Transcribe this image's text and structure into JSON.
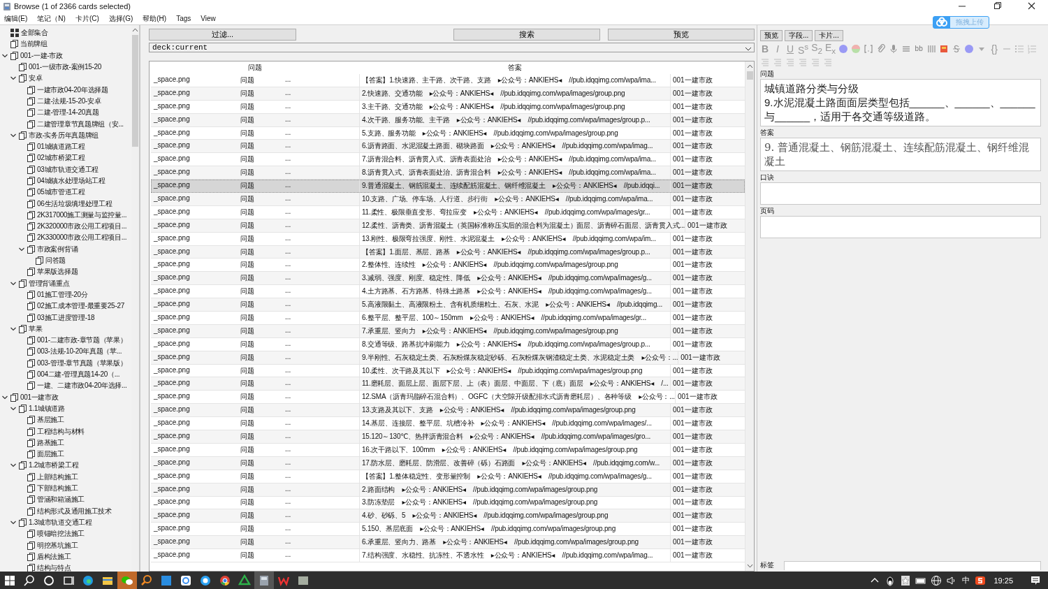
{
  "window": {
    "title": "Browse (1 of 2366 cards selected)"
  },
  "menu": [
    "编辑(E)",
    "笔记（N)",
    "卡片(C)",
    "选择(G)",
    "帮助(H)",
    "Tags",
    "View"
  ],
  "upload_button": {
    "label": "拖拽上传"
  },
  "sidebar": {
    "items": [
      {
        "label": "全部集合",
        "kind": "collection"
      },
      {
        "label": "当前牌组",
        "kind": "deck"
      },
      {
        "label": "001-一建-市政",
        "kind": "deck",
        "expanded": true,
        "children": [
          {
            "label": "001-一级市政-案例15-20",
            "kind": "deck"
          },
          {
            "label": "安卓",
            "kind": "deck",
            "expanded": true,
            "children": [
              {
                "label": "一建市政04-20年选择题",
                "kind": "deck"
              },
              {
                "label": "二建-法规-15-20-安卓",
                "kind": "deck"
              },
              {
                "label": "二建-管理-14-20真题",
                "kind": "deck"
              },
              {
                "label": "二建管理章节真题牌组（安...",
                "kind": "deck"
              }
            ]
          },
          {
            "label": "市政-实务历年真题牌组",
            "kind": "deck",
            "expanded": true,
            "children": [
              {
                "label": "01城镇道路工程",
                "kind": "deck"
              },
              {
                "label": "02城市桥梁工程",
                "kind": "deck"
              },
              {
                "label": "03城市轨道交通工程",
                "kind": "deck"
              },
              {
                "label": "04城镇水处理场站工程",
                "kind": "deck"
              },
              {
                "label": "05城市管道工程",
                "kind": "deck"
              },
              {
                "label": "06生活垃圾填埋处理工程",
                "kind": "deck"
              },
              {
                "label": "2K317000施工测量与监控量...",
                "kind": "deck"
              },
              {
                "label": "2K320000市政公用工程项目...",
                "kind": "deck"
              },
              {
                "label": "2K330000市政公用工程项目...",
                "kind": "deck"
              },
              {
                "label": "市政案例背诵",
                "kind": "deck",
                "expanded": true,
                "children": [
                  {
                    "label": "问答题",
                    "kind": "deck"
                  }
                ]
              },
              {
                "label": "苹果版选择题",
                "kind": "deck"
              }
            ]
          },
          {
            "label": "管理背诵重点",
            "kind": "deck",
            "expanded": true,
            "children": [
              {
                "label": "01施工管理-20分",
                "kind": "deck"
              },
              {
                "label": "02施工成本管理-最重要25-27",
                "kind": "deck"
              },
              {
                "label": "03施工进度管理-18",
                "kind": "deck"
              }
            ]
          },
          {
            "label": "苹果",
            "kind": "deck",
            "expanded": true,
            "children": [
              {
                "label": "001-二建市政-章节题（苹果）",
                "kind": "deck"
              },
              {
                "label": "003-法规-10-20年真题（苹...",
                "kind": "deck"
              },
              {
                "label": "003-管理-章节真题（苹果版）",
                "kind": "deck"
              },
              {
                "label": "004二建-管理真题14-20（...",
                "kind": "deck"
              },
              {
                "label": "一建、二建市政04-20年选择...",
                "kind": "deck"
              }
            ]
          }
        ]
      },
      {
        "label": "001一建市政",
        "kind": "deck",
        "expanded": true,
        "children": [
          {
            "label": "1.1城镇道路",
            "kind": "deck",
            "expanded": true,
            "children": [
              {
                "label": "基层施工",
                "kind": "deck"
              },
              {
                "label": "工程结构与材料",
                "kind": "deck"
              },
              {
                "label": "路基施工",
                "kind": "deck"
              },
              {
                "label": "面层施工",
                "kind": "deck"
              }
            ]
          },
          {
            "label": "1.2城市桥梁工程",
            "kind": "deck",
            "expanded": true,
            "children": [
              {
                "label": "上部结构施工",
                "kind": "deck"
              },
              {
                "label": "下部结构施工",
                "kind": "deck"
              },
              {
                "label": "管涵和箱涵施工",
                "kind": "deck"
              },
              {
                "label": "结构形式及通用施工技术",
                "kind": "deck"
              }
            ]
          },
          {
            "label": "1.3城市轨道交通工程",
            "kind": "deck",
            "expanded": true,
            "children": [
              {
                "label": "喷锚暗挖法施工",
                "kind": "deck"
              },
              {
                "label": "明挖基坑施工",
                "kind": "deck"
              },
              {
                "label": "盾构法施工",
                "kind": "deck"
              },
              {
                "label": "结构与特点",
                "kind": "deck"
              }
            ]
          }
        ]
      }
    ]
  },
  "toolbar": {
    "filter_button": "过滤...",
    "search_button": "搜索",
    "preview_button": "预览",
    "search": {
      "value": "deck:current"
    }
  },
  "table": {
    "columns": [
      "问题",
      "答案"
    ],
    "rows": [
      {
        "question": [
          "_space.png",
          "问题",
          "..."
        ],
        "answer": "【答案】1.快速路、主干路、次干路、支路    ▸公众号：ANKIEHS◂    //pub.idqqimg.com/wpa/ima...",
        "deck": "001一建市政",
        "selected": false
      },
      {
        "question": [
          "_space.png",
          "问题",
          "..."
        ],
        "answer": "2.快速路、交通功能    ▸公众号：ANKIEHS◂    //pub.idqqimg.com/wpa/images/group.png",
        "deck": "001一建市政",
        "selected": false
      },
      {
        "question": [
          "_space.png",
          "问题",
          "..."
        ],
        "answer": "3.主干路、交通功能    ▸公众号：ANKIEHS◂    //pub.idqqimg.com/wpa/images/group.png",
        "deck": "001一建市政",
        "selected": false
      },
      {
        "question": [
          "_space.png",
          "问题",
          "..."
        ],
        "answer": "4.次干路、服务功能、主干路    ▸公众号：ANKIEHS◂    //pub.idqqimg.com/wpa/images/group.p...",
        "deck": "001一建市政",
        "selected": false
      },
      {
        "question": [
          "_space.png",
          "问题",
          "..."
        ],
        "answer": "5.支路、服务功能    ▸公众号：ANKIEHS◂    //pub.idqqimg.com/wpa/images/group.png",
        "deck": "001一建市政",
        "selected": false
      },
      {
        "question": [
          "_space.png",
          "问题",
          "..."
        ],
        "answer": "6.沥青路面、水泥混凝土路面、砌块路面    ▸公众号：ANKIEHS◂    //pub.idqqimg.com/wpa/imag...",
        "deck": "001一建市政",
        "selected": false
      },
      {
        "question": [
          "_space.png",
          "问题",
          "..."
        ],
        "answer": "7.沥青混合料、沥青贯入式、沥青表面处治    ▸公众号：ANKIEHS◂    //pub.idqqimg.com/wpa/ima...",
        "deck": "001一建市政",
        "selected": false
      },
      {
        "question": [
          "_space.png",
          "问题",
          "..."
        ],
        "answer": "8.沥青贯入式、沥青表面处治、沥青混合料    ▸公众号：ANKIEHS◂    //pub.idqqimg.com/wpa/ima...",
        "deck": "001一建市政",
        "selected": false
      },
      {
        "question": [
          "_space.png",
          "问题",
          "..."
        ],
        "answer": "9.普通混凝土、钢筋混凝土、连续配筋混凝土、钢纤维混凝土    ▸公众号：ANKIEHS◂    //pub.idqqi...",
        "deck": "001一建市政",
        "selected": true
      },
      {
        "question": [
          "_space.png",
          "问题",
          "..."
        ],
        "answer": "10.支路、广场、停车场、人行道、步行街    ▸公众号：ANKIEHS◂    //pub.idqqimg.com/wpa/ima...",
        "deck": "001一建市政",
        "selected": false
      },
      {
        "question": [
          "_space.png",
          "问题",
          "..."
        ],
        "answer": "11.柔性、极限垂直变形、弯拉应变    ▸公众号：ANKIEHS◂    //pub.idqqimg.com/wpa/images/gr...",
        "deck": "001一建市政",
        "selected": false
      },
      {
        "question": [
          "_space.png",
          "问题",
          "..."
        ],
        "answer": "12.柔性、沥青类、沥青混凝土（英国标准称压实后的混合料为混凝土）面层、沥青碎石面层、沥青贯入式...",
        "deck": "001一建市政",
        "selected": false
      },
      {
        "question": [
          "_space.png",
          "问题",
          "..."
        ],
        "answer": "13.刚性、极限弯拉强度、刚性、水泥混凝土    ▸公众号：ANKIEHS◂    //pub.idqqimg.com/wpa/im...",
        "deck": "001一建市政",
        "selected": false
      },
      {
        "question": [
          "_space.png",
          "问题",
          "..."
        ],
        "answer": "【答案】1.面层、基层、路基    ▸公众号：ANKIEHS◂    //pub.idqqimg.com/wpa/images/group.p...",
        "deck": "001一建市政",
        "selected": false
      },
      {
        "question": [
          "_space.png",
          "问题",
          "..."
        ],
        "answer": "2.整体性、连续性    ▸公众号：ANKIEHS◂    //pub.idqqimg.com/wpa/images/group.png",
        "deck": "001一建市政",
        "selected": false
      },
      {
        "question": [
          "_space.png",
          "问题",
          "..."
        ],
        "answer": "3.减弱、强度、刚度、稳定性、降低    ▸公众号：ANKIEHS◂    //pub.idqqimg.com/wpa/images/g...",
        "deck": "001一建市政",
        "selected": false
      },
      {
        "question": [
          "_space.png",
          "问题",
          "..."
        ],
        "answer": "4.土方路基、石方路基、特殊土路基    ▸公众号：ANKIEHS◂    //pub.idqqimg.com/wpa/images/g...",
        "deck": "001一建市政",
        "selected": false
      },
      {
        "question": [
          "_space.png",
          "问题",
          "..."
        ],
        "answer": "5.高液限黏土、高液限粉土、含有机质细粒土、石灰、水泥    ▸公众号：ANKIEHS◂    //pub.idqqimg...",
        "deck": "001一建市政",
        "selected": false
      },
      {
        "question": [
          "_space.png",
          "问题",
          "..."
        ],
        "answer": "6.整平层、整平层、100～150mm    ▸公众号：ANKIEHS◂    //pub.idqqimg.com/wpa/images/gr...",
        "deck": "001一建市政",
        "selected": false
      },
      {
        "question": [
          "_space.png",
          "问题",
          "..."
        ],
        "answer": "7.承重层、竖向力    ▸公众号：ANKIEHS◂    //pub.idqqimg.com/wpa/images/group.png",
        "deck": "001一建市政",
        "selected": false
      },
      {
        "question": [
          "_space.png",
          "问题",
          "..."
        ],
        "answer": "8.交通等级、路基抗冲刷能力    ▸公众号：ANKIEHS◂    //pub.idqqimg.com/wpa/images/group.p...",
        "deck": "001一建市政",
        "selected": false
      },
      {
        "question": [
          "_space.png",
          "问题",
          "..."
        ],
        "answer": "9.半刚性、石灰稳定土类、石灰粉煤灰稳定砂砾、石灰粉煤灰钢渣稳定土类、水泥稳定土类    ▸公众号：...",
        "deck": "001一建市政",
        "selected": false
      },
      {
        "question": [
          "_space.png",
          "问题",
          "..."
        ],
        "answer": "10.柔性、次干路及其以下    ▸公众号：ANKIEHS◂    //pub.idqqimg.com/wpa/images/group.png",
        "deck": "001一建市政",
        "selected": false
      },
      {
        "question": [
          "_space.png",
          "问题",
          "..."
        ],
        "answer": "11.磨耗层、面层上层、面层下层、上（表）面层、中面层、下（底）面层    ▸公众号：ANKIEHS◂    /...",
        "deck": "001一建市政",
        "selected": false
      },
      {
        "question": [
          "_space.png",
          "问题",
          "..."
        ],
        "answer": "12.SMA（沥青玛脂碎石混合料）、OGFC（大空隙开级配排水式沥青磨耗层）、各种等级    ▸公众号：...",
        "deck": "001一建市政",
        "selected": false
      },
      {
        "question": [
          "_space.png",
          "问题",
          "..."
        ],
        "answer": "13.支路及其以下、支路    ▸公众号：ANKIEHS◂    //pub.idqqimg.com/wpa/images/group.png",
        "deck": "001一建市政",
        "selected": false
      },
      {
        "question": [
          "_space.png",
          "问题",
          "..."
        ],
        "answer": "14.基层、连接层、整平层、坑槽冷补    ▸公众号：ANKIEHS◂    //pub.idqqimg.com/wpa/images/...",
        "deck": "001一建市政",
        "selected": false
      },
      {
        "question": [
          "_space.png",
          "问题",
          "..."
        ],
        "answer": "15.120～130℃、热拌沥青混合料    ▸公众号：ANKIEHS◂    //pub.idqqimg.com/wpa/images/gro...",
        "deck": "001一建市政",
        "selected": false
      },
      {
        "question": [
          "_space.png",
          "问题",
          "..."
        ],
        "answer": "16.次干路以下、100mm    ▸公众号：ANKIEHS◂    //pub.idqqimg.com/wpa/images/group.png",
        "deck": "001一建市政",
        "selected": false
      },
      {
        "question": [
          "_space.png",
          "问题",
          "..."
        ],
        "answer": "17.防水层、磨耗层、防滑层、改善碎（砾）石路面    ▸公众号：ANKIEHS◂    //pub.idqqimg.com/w...",
        "deck": "001一建市政",
        "selected": false
      },
      {
        "question": [
          "_space.png",
          "问题",
          "..."
        ],
        "answer": "【答案】1.整体稳定性、变形量控制    ▸公众号：ANKIEHS◂    //pub.idqqimg.com/wpa/images/g...",
        "deck": "001一建市政",
        "selected": false
      },
      {
        "question": [
          "_space.png",
          "问题",
          "..."
        ],
        "answer": "2.路面结构    ▸公众号：ANKIEHS◂    //pub.idqqimg.com/wpa/images/group.png",
        "deck": "001一建市政",
        "selected": false
      },
      {
        "question": [
          "_space.png",
          "问题",
          "..."
        ],
        "answer": "3.防冻垫层    ▸公众号：ANKIEHS◂    //pub.idqqimg.com/wpa/images/group.png",
        "deck": "001一建市政",
        "selected": false
      },
      {
        "question": [
          "_space.png",
          "问题",
          "..."
        ],
        "answer": "4.砂、砂砾、5    ▸公众号：ANKIEHS◂    //pub.idqqimg.com/wpa/images/group.png",
        "deck": "001一建市政",
        "selected": false
      },
      {
        "question": [
          "_space.png",
          "问题",
          "..."
        ],
        "answer": "5.150、基层底面    ▸公众号：ANKIEHS◂    //pub.idqqimg.com/wpa/images/group.png",
        "deck": "001一建市政",
        "selected": false
      },
      {
        "question": [
          "_space.png",
          "问题",
          "..."
        ],
        "answer": "6.承重层、竖向力、路基    ▸公众号：ANKIEHS◂    //pub.idqqimg.com/wpa/images/group.png",
        "deck": "001一建市政",
        "selected": false
      },
      {
        "question": [
          "_space.png",
          "问题",
          "..."
        ],
        "answer": "7.结构强度、水稳性、抗冻性、不透水性    ▸公众号：ANKIEHS◂    //pub.idqqimg.com/wpa/imag...",
        "deck": "001一建市政",
        "selected": false
      }
    ]
  },
  "editor": {
    "buttons": [
      "预览",
      "字段...",
      "卡片..."
    ],
    "format_toolbar": [
      {
        "kind": "text",
        "label": "B"
      },
      {
        "kind": "text",
        "label": "I"
      },
      {
        "kind": "text",
        "label": "U"
      },
      {
        "kind": "text",
        "label": "S$^{s}$"
      },
      {
        "kind": "text",
        "label": "S$_{2}$"
      },
      {
        "kind": "text",
        "label": "E$_{x}$"
      },
      {
        "kind": "icon"
      },
      {
        "kind": "icon"
      },
      {
        "kind": "icon"
      },
      {
        "kind": "icon"
      },
      {
        "kind": "icon"
      },
      {
        "kind": "icon"
      },
      {
        "kind": "text",
        "label": "bb"
      },
      {
        "kind": "icon"
      },
      {
        "kind": "icon"
      },
      {
        "kind": "icon"
      },
      {
        "kind": "icon"
      },
      {
        "kind": "icon"
      },
      {
        "kind": "text",
        "label": "{}"
      },
      {
        "kind": "icon"
      },
      {
        "kind": "icon"
      },
      {
        "kind": "icon"
      }
    ],
    "fields": [
      {
        "label": "问题",
        "lines": [
          "城镇道路分类与分级",
          "9.水泥混凝土路面面层类型包括______、______、______与______，适用于各交通等级道路。"
        ]
      },
      {
        "label": "答案",
        "lines": [
          "9. 普通混凝土、钢筋混凝土、连续配筋混凝土、钢纤维混凝土"
        ]
      },
      {
        "label": "口诀"
      },
      {
        "label": "页码"
      }
    ],
    "tags": {
      "label": "标签"
    }
  },
  "taskbar": {
    "ime": "中",
    "clock": "19:25"
  }
}
